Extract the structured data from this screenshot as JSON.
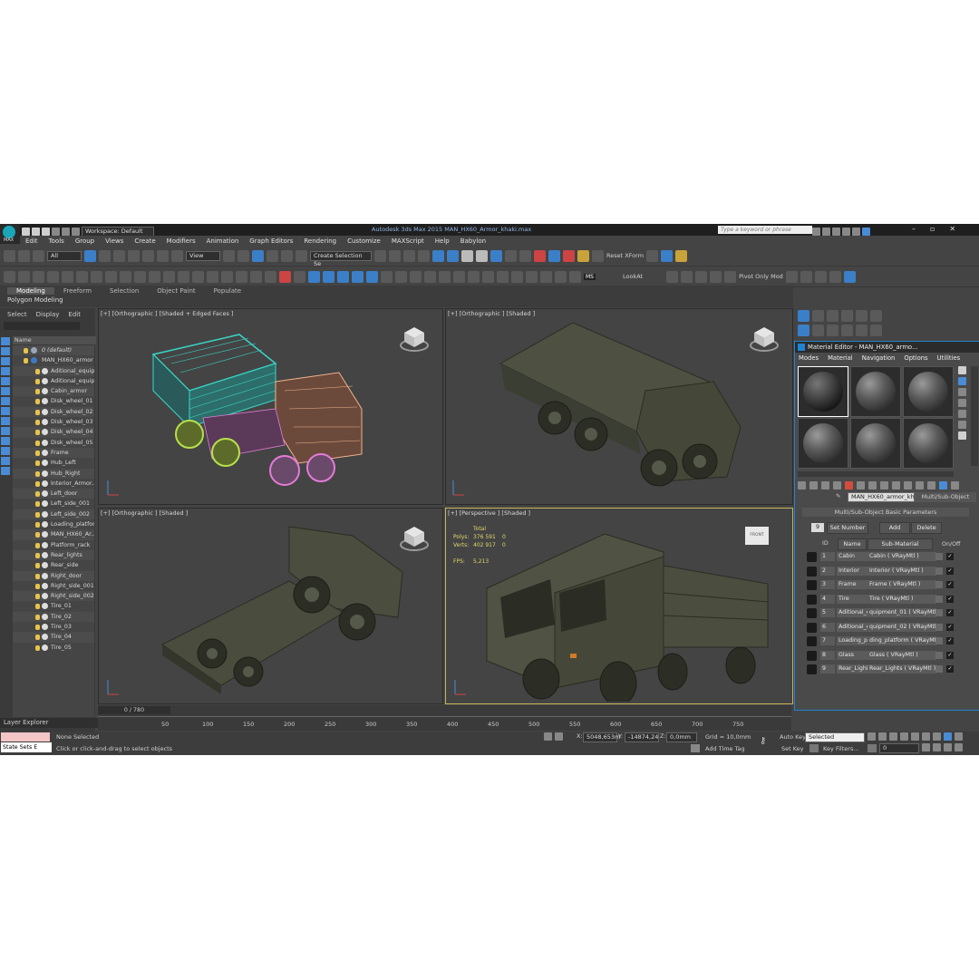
{
  "app": {
    "title": "Autodesk 3ds Max 2015    MAN_HX60_Armor_khaki.max",
    "logo_text": "MAX",
    "workspace": "Workspace: Default",
    "search_placeholder": "Type a keyword or phrase"
  },
  "menu": [
    "Edit",
    "Tools",
    "Group",
    "Views",
    "Create",
    "Modifiers",
    "Animation",
    "Graph Editors",
    "Rendering",
    "Customize",
    "MAXScript",
    "Help",
    "Babylon"
  ],
  "toolbar": {
    "filter": "All",
    "view_combo": "View",
    "selection_set": "Create Selection Se",
    "reset_xform": "Reset XForm",
    "lookat": "LookAt",
    "pivot_only": "Pivot Only Mod",
    "ms_label": "MS"
  },
  "ribbon": {
    "tabs": [
      "Modeling",
      "Freeform",
      "Selection",
      "Object Paint",
      "Populate"
    ],
    "sub": "Polygon Modeling"
  },
  "scene_explorer": {
    "tabs": [
      "Select",
      "Display",
      "Edit"
    ],
    "column": "Name",
    "items": [
      "0 (default)",
      "MAN_HX60_armor",
      "Aditional_equip...",
      "Aditional_equip...",
      "Cabin_armor",
      "Disk_wheel_01",
      "Disk_wheel_02",
      "Disk_wheel_03",
      "Disk_wheel_04",
      "Disk_wheel_05",
      "Frame",
      "Hub_Left",
      "Hub_Right",
      "Interior_Armor...",
      "Left_door",
      "Left_side_001",
      "Left_side_002",
      "Loading_platfor...",
      "MAN_HX60_Ar...",
      "Platform_rack",
      "Rear_lights",
      "Rear_side",
      "Right_door",
      "Right_side_001",
      "Right_side_002",
      "Tire_01",
      "Tire_02",
      "Tire_03",
      "Tire_04",
      "Tire_05"
    ],
    "layer_explorer": "Layer Explorer"
  },
  "viewports": {
    "top_left": "[+] [Orthographic ] [Shaded + Edged Faces ]",
    "top_right": "[+] [Orthographic ] [Shaded ]",
    "bottom_left": "[+] [Orthographic ] [Shaded ]",
    "bottom_right": "[+] [Perspective ] [Shaded ]",
    "stats": {
      "total_label": "Total",
      "polys_label": "Polys:",
      "polys_total": "376 591",
      "polys_sel": "0",
      "verts_label": "Verts:",
      "verts_total": "402 917",
      "verts_sel": "0",
      "fps_label": "FPS:",
      "fps": "5,213"
    },
    "viewcube_label": "FRONT"
  },
  "timeline": {
    "frame": "0 / 780",
    "ticks": [
      "50",
      "100",
      "150",
      "200",
      "250",
      "300",
      "350",
      "400",
      "450",
      "500",
      "550",
      "600",
      "650",
      "700",
      "750"
    ]
  },
  "status": {
    "state_sets": "State Sets E",
    "selection": "None Selected",
    "prompt": "Click or click-and-drag to select objects",
    "x_label": "X:",
    "x_val": "5048,653m",
    "y_label": "Y:",
    "y_val": "-14874,24",
    "z_label": "Z:",
    "z_val": "0,0mm",
    "grid": "Grid = 10,0mm",
    "add_time_tag": "Add Time Tag",
    "auto_key": "Auto Key",
    "set_key": "Set Key",
    "selected": "Selected",
    "key_filters": "Key Filters...",
    "frame_field": "0"
  },
  "material_editor": {
    "title": "Material Editor - MAN_HX60_armo...",
    "menu": [
      "Modes",
      "Material",
      "Navigation",
      "Options",
      "Utilities"
    ],
    "material_name": "MAN_HX60_armor_khaki",
    "material_type": "Multi/Sub-Object",
    "rollout": "Multi/Sub-Object Basic Parameters",
    "set_number_value": "9",
    "set_number": "Set Number",
    "add": "Add",
    "delete": "Delete",
    "headers": {
      "id": "ID",
      "name": "Name",
      "sub": "Sub-Material",
      "onoff": "On/Off"
    },
    "rows": [
      {
        "id": "1",
        "name": "Cabin",
        "sub": "Cabin  ( VRayMtl )"
      },
      {
        "id": "2",
        "name": "Interior",
        "sub": "Interior  ( VRayMtl )"
      },
      {
        "id": "3",
        "name": "Frame",
        "sub": "Frame  ( VRayMtl )"
      },
      {
        "id": "4",
        "name": "Tire",
        "sub": "Tire  ( VRayMtl )"
      },
      {
        "id": "5",
        "name": "Aditional_e",
        "sub": "quipment_01  ( VRayMtl )"
      },
      {
        "id": "6",
        "name": "Aditional_e",
        "sub": "quipment_02  ( VRayMtl )"
      },
      {
        "id": "7",
        "name": "Loading_pl",
        "sub": "ding_platform  ( VRayMtl )"
      },
      {
        "id": "8",
        "name": "Glass",
        "sub": "Glass  ( VRayMtl )"
      },
      {
        "id": "9",
        "name": "Rear_Lighi",
        "sub": "Rear_Lights  ( VRayMtl )"
      }
    ],
    "check": "✓"
  },
  "colors": {
    "accent": "#1f83d1",
    "wire_cyan": "#39d6c8",
    "wire_pink": "#e57bd8",
    "wire_peach": "#f2b48a",
    "wire_green": "#b6e04c",
    "truck": "#4c5040"
  }
}
